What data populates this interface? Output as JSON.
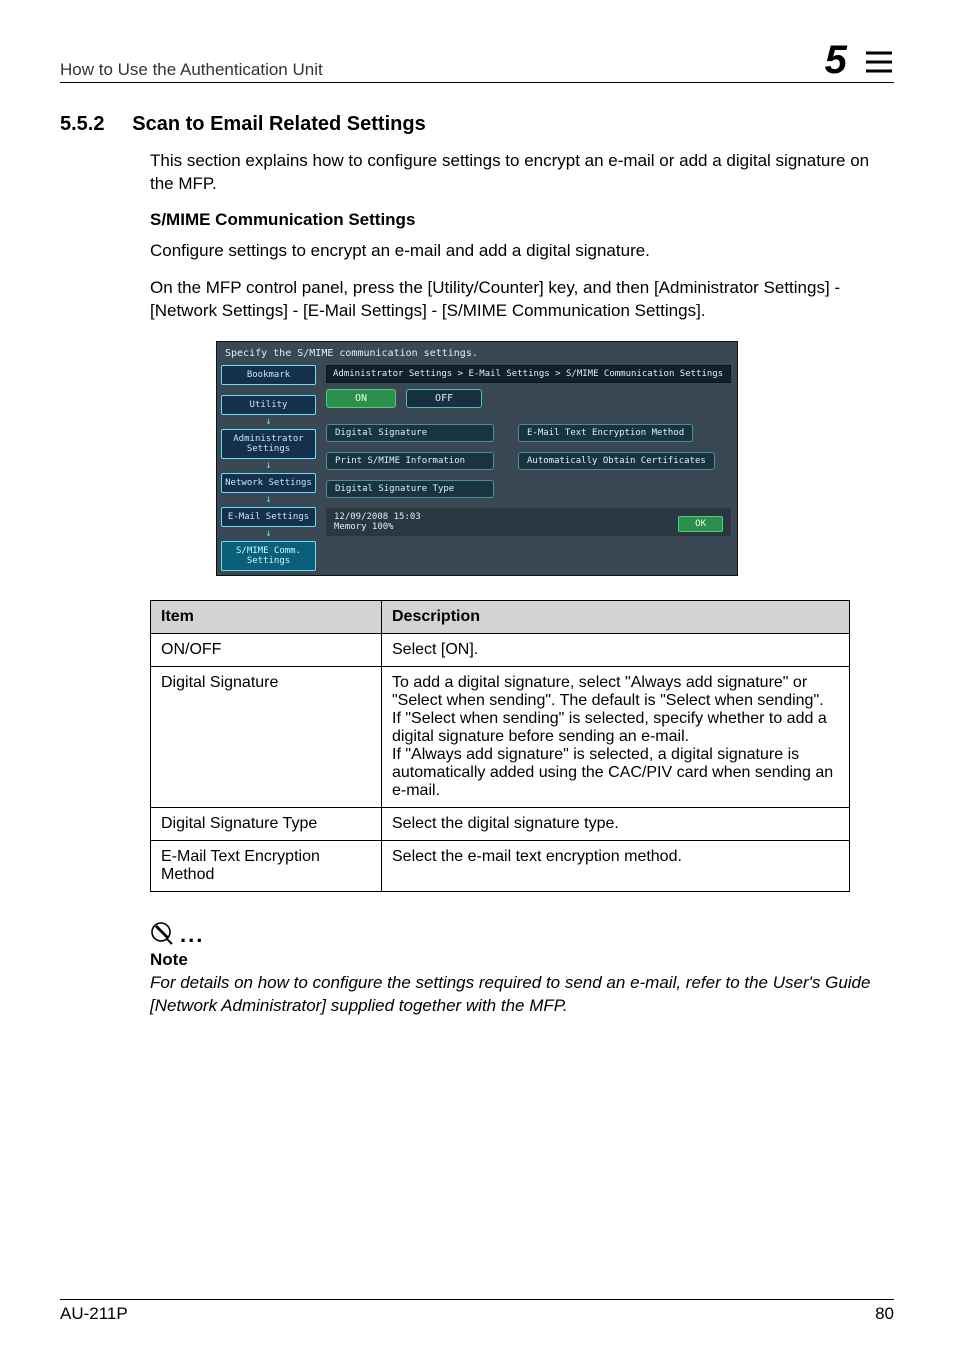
{
  "header": {
    "title": "How to Use the Authentication Unit",
    "chapter": "5"
  },
  "section": {
    "number": "5.5.2",
    "title": "Scan to Email Related Settings"
  },
  "intro": "This section explains how to configure settings to encrypt an e-mail or add a digital signature on the MFP.",
  "subhead": "S/MIME Communication Settings",
  "para1": "Configure settings to encrypt an e-mail and add a digital signature.",
  "para2": "On the MFP control panel, press the [Utility/Counter] key, and then [Administrator Settings] - [Network Settings] - [E-Mail Settings] - [S/MIME Communication Settings].",
  "mfp": {
    "topline": "Specify the S/MIME communication settings.",
    "bookmark": "Bookmark",
    "left": {
      "utility": "Utility",
      "admin": "Administrator Settings",
      "network": "Network Settings",
      "email": "E-Mail Settings",
      "smime": "S/MIME Comm. Settings"
    },
    "path": "Administrator Settings > E-Mail Settings > S/MIME Communication Settings",
    "on": "ON",
    "off": "OFF",
    "opts": {
      "sig": "Digital Signature",
      "enc": "E-Mail Text Encryption Method",
      "print": "Print S/MIME Information",
      "auto": "Automatically Obtain Certificates",
      "sigtype": "Digital Signature Type"
    },
    "datetime": "12/09/2008   15:03",
    "memory": "Memory      100%",
    "ok": "OK"
  },
  "table": {
    "h1": "Item",
    "h2": "Description",
    "rows": [
      {
        "item": "ON/OFF",
        "desc": "Select [ON]."
      },
      {
        "item": "Digital Signature",
        "desc": "To add a digital signature, select \"Always add signature\" or \"Select when sending\". The default is \"Select when sending\".\nIf \"Select when sending\" is selected, specify whether to add a digital signature before sending an e-mail.\nIf \"Always add signature\" is selected, a digital signature is automatically added using the CAC/PIV card when sending an e-mail."
      },
      {
        "item": "Digital Signature Type",
        "desc": "Select the digital signature type."
      },
      {
        "item": "E-Mail Text Encryption Method",
        "desc": "Select the e-mail text encryption method."
      }
    ]
  },
  "note": {
    "label": "Note",
    "text": "For details on how to configure the settings required to send an e-mail, refer to the User's Guide [Network Administrator] supplied together with the MFP."
  },
  "footer": {
    "left": "AU-211P",
    "right": "80"
  }
}
